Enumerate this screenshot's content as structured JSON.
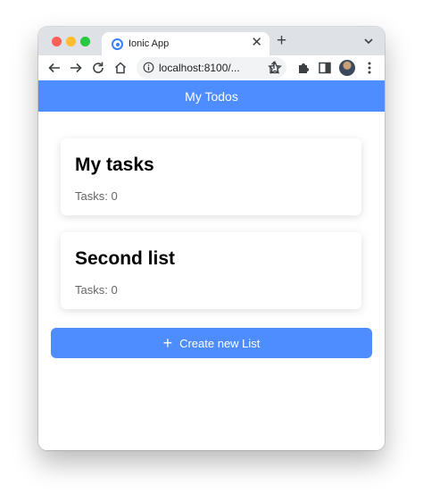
{
  "browser": {
    "tab": {
      "title": "Ionic App",
      "close_glyph": "✕"
    },
    "new_tab_glyph": "+",
    "address": {
      "url": "localhost:8100/..."
    },
    "icons": [
      "back-icon",
      "forward-icon",
      "reload-icon",
      "home-icon",
      "info-icon",
      "share-icon",
      "bookmark-star-icon",
      "extensions-icon",
      "side-panel-icon",
      "profile-avatar",
      "more-menu-icon",
      "tab-search-chevron-icon"
    ]
  },
  "app": {
    "title": "My Todos",
    "lists": [
      {
        "name": "My tasks",
        "count_label": "Tasks: 0"
      },
      {
        "name": "Second list",
        "count_label": "Tasks: 0"
      }
    ],
    "create_button": {
      "icon": "add-icon",
      "glyph": "+",
      "label": "Create new List"
    }
  },
  "colors": {
    "accent": "#4d8dff",
    "tabstrip": "#dee1e6",
    "card_subtext": "#666666"
  }
}
